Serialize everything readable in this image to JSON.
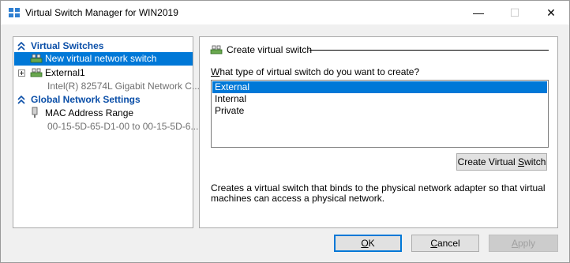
{
  "window": {
    "title": "Virtual Switch Manager for WIN2019",
    "minimize_glyph": "—",
    "maximize_glyph": "☐",
    "close_glyph": "✕"
  },
  "tree": {
    "sections": [
      {
        "label": "Virtual Switches",
        "items": [
          {
            "label": "New virtual network switch",
            "selected": true,
            "icon": "network-switch-icon"
          },
          {
            "label": "External1",
            "sub": "Intel(R) 82574L Gigabit Network C...",
            "icon": "network-switch-icon",
            "expandable": true
          }
        ]
      },
      {
        "label": "Global Network Settings",
        "items": [
          {
            "label": "MAC Address Range",
            "sub": "00-15-5D-65-D1-00 to 00-15-5D-6...",
            "icon": "network-adapter-icon"
          }
        ]
      }
    ]
  },
  "panel": {
    "header": "Create virtual switch",
    "question_prefix": "",
    "question_access": "W",
    "question_rest": "hat type of virtual switch do you want to create?",
    "options": [
      "External",
      "Internal",
      "Private"
    ],
    "selected_option": "External",
    "create_button_pre": "Create Virtual ",
    "create_button_access": "S",
    "create_button_post": "witch",
    "description": "Creates a virtual switch that binds to the physical network adapter so that virtual machines can access a physical network."
  },
  "footer": {
    "ok_access": "O",
    "ok_rest": "K",
    "cancel_access": "C",
    "cancel_rest": "ancel",
    "apply_access": "A",
    "apply_rest": "pply"
  },
  "colors": {
    "accent": "#0078d7",
    "section_header": "#0b4fa8",
    "muted_text": "#707070"
  }
}
